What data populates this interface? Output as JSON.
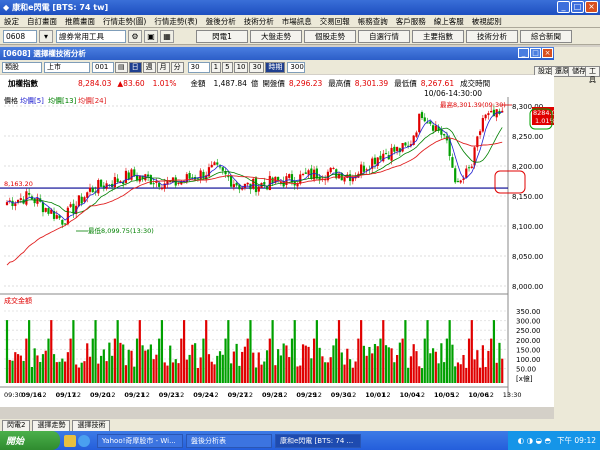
{
  "window": {
    "title": "康和e閃電 [BTS: 74 tw]"
  },
  "menu": [
    "設定",
    "自訂畫面",
    "推薦畫面",
    "行情走勢(圖)",
    "行情走勢(表)",
    "盤後分析",
    "技術分析",
    "市場訊息",
    "交易回報",
    "帳務查詢",
    "客戶服務",
    "線上客服",
    "被視認別"
  ],
  "toolbar": {
    "code": "0608",
    "group": "證券常用工具",
    "buttons": [
      "閃電1",
      "大盤走勢",
      "個股走勢",
      "自選行情",
      "主要指數",
      "技術分析",
      "綜合新聞"
    ]
  },
  "inner": {
    "title": "[0608] 選擇權技術分析"
  },
  "controls": {
    "type": "類股",
    "market": "上市",
    "code": "001",
    "periods": [
      "日",
      "週",
      "月",
      "分"
    ],
    "minute": "30",
    "intervals": [
      "1",
      "5",
      "10",
      "30",
      "時期"
    ],
    "count": "300",
    "right_buttons": [
      "設定",
      "還原",
      "儲存",
      "工具"
    ]
  },
  "info": {
    "name": "加權指數",
    "close": "8,284.03",
    "change": "▲83.60",
    "pct": "1.01%",
    "amount_label": "金額",
    "amount": "1,487.84",
    "amount_unit": "億",
    "open_label": "開盤價",
    "open": "8,296.23",
    "high_label": "最高價",
    "high": "8,301.39",
    "low_label": "最低價",
    "low": "8,267.61",
    "time_label": "成交時間",
    "time": "10/06-14:30:00"
  },
  "price_legend": {
    "label": "價格",
    "ma5": "均價[5]",
    "ma13": "均價[13]",
    "ma24": "均價[24]"
  },
  "volume_legend": "成交金額",
  "annotations": {
    "high": "最高8,301.39(09:30)",
    "low": "最低8,099.75(13:30)",
    "hline": "8,163.20",
    "badge_price": "8284.03",
    "badge_pct": "1.01%"
  },
  "price_axis": [
    "8,300.00",
    "8,250.00",
    "8,200.00",
    "8,150.00",
    "8,100.00",
    "8,050.00",
    "8,000.00"
  ],
  "volume_axis": [
    "350.00",
    "300.00",
    "250.00",
    "200.00",
    "150.00",
    "100.00",
    "50.00",
    "[x億]"
  ],
  "dates": [
    "09:30",
    "09/16",
    "12",
    "09/17",
    "12",
    "09/20",
    "12",
    "09/21",
    "12",
    "09/23",
    "12",
    "09/24",
    "12",
    "09/27",
    "12",
    "09/28",
    "12",
    "09/29",
    "12",
    "09/30",
    "12",
    "10/01",
    "12",
    "10/04",
    "12",
    "10/05",
    "12",
    "10/06",
    "12",
    "13:30"
  ],
  "tabs": [
    "閃電2",
    "選擇走勢",
    "選擇技術"
  ],
  "taskbar": {
    "start": "開始",
    "tasks": [
      "Yahoo!奇摩股市 - Wi...",
      "盤後分析表",
      "康和e閃電 [BTS: 74 ..."
    ],
    "clock": "下午 09:12"
  },
  "colors": {
    "up": "#e00000",
    "down": "#00a000",
    "ma5": "#2020d0",
    "ma13": "#008000",
    "ma24": "#e02020",
    "hline": "#000090"
  }
}
